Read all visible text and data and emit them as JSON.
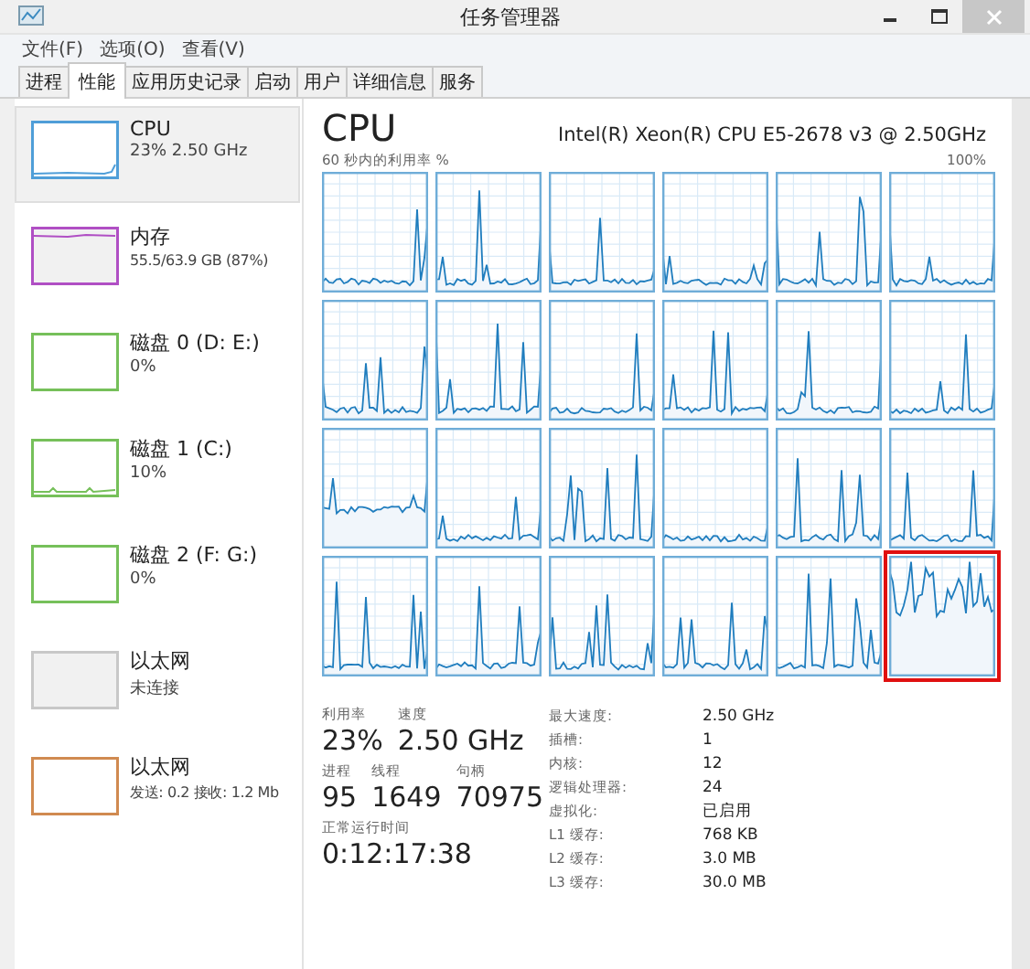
{
  "window": {
    "title": "任务管理器"
  },
  "menu": [
    "文件(F)",
    "选项(O)",
    "查看(V)"
  ],
  "tabs": [
    {
      "label": "进程",
      "selected": false
    },
    {
      "label": "性能",
      "selected": true
    },
    {
      "label": "应用历史记录",
      "selected": false
    },
    {
      "label": "启动",
      "selected": false
    },
    {
      "label": "用户",
      "selected": false
    },
    {
      "label": "详细信息",
      "selected": false
    },
    {
      "label": "服务",
      "selected": false
    }
  ],
  "sidebar": {
    "items": [
      {
        "name": "CPU",
        "detail": "23% 2.50 GHz",
        "color": "#4f9ed8",
        "selected": true
      },
      {
        "name": "内存",
        "detail": "55.5/63.9 GB (87%)",
        "color": "#b04fc4",
        "selected": false
      },
      {
        "name": "磁盘 0 (D: E:)",
        "detail": "0%",
        "color": "#76c05a",
        "selected": false
      },
      {
        "name": "磁盘 1 (C:)",
        "detail": "10%",
        "color": "#76c05a",
        "selected": false
      },
      {
        "name": "磁盘 2 (F: G:)",
        "detail": "0%",
        "color": "#76c05a",
        "selected": false
      },
      {
        "name": "以太网",
        "detail": "未连接",
        "color": "#c8c8c8",
        "selected": false
      },
      {
        "name": "以太网",
        "detail": "发送: 0.2 接收: 1.2 Mb",
        "color": "#d08a50",
        "selected": false
      }
    ]
  },
  "panel": {
    "title": "CPU",
    "processor": "Intel(R) Xeon(R) CPU E5-2678 v3 @ 2.50GHz",
    "graph_caption": "60 秒内的利用率 %",
    "graph_max": "100%",
    "core_graphs": [
      {
        "highlighted": false
      },
      {
        "highlighted": false
      },
      {
        "highlighted": false
      },
      {
        "highlighted": false
      },
      {
        "highlighted": false
      },
      {
        "highlighted": false
      },
      {
        "highlighted": false
      },
      {
        "highlighted": false
      },
      {
        "highlighted": false
      },
      {
        "highlighted": false
      },
      {
        "highlighted": false
      },
      {
        "highlighted": false
      },
      {
        "highlighted": false
      },
      {
        "highlighted": false
      },
      {
        "highlighted": false
      },
      {
        "highlighted": false
      },
      {
        "highlighted": false
      },
      {
        "highlighted": false
      },
      {
        "highlighted": false
      },
      {
        "highlighted": false
      },
      {
        "highlighted": false
      },
      {
        "highlighted": false
      },
      {
        "highlighted": false
      },
      {
        "highlighted": true
      }
    ],
    "stats": [
      [
        {
          "label": "利用率",
          "value": "23%"
        },
        {
          "label": "速度",
          "value": "2.50 GHz"
        }
      ],
      [
        {
          "label": "进程",
          "value": "95"
        },
        {
          "label": "线程",
          "value": "1649"
        },
        {
          "label": "句柄",
          "value": "70975"
        }
      ],
      [
        {
          "label": "正常运行时间",
          "value": "0:12:17:38"
        }
      ]
    ],
    "details": [
      {
        "label": "最大速度:",
        "value": "2.50 GHz"
      },
      {
        "label": "插槽:",
        "value": "1"
      },
      {
        "label": "内核:",
        "value": "12"
      },
      {
        "label": "逻辑处理器:",
        "value": "24"
      },
      {
        "label": "虚拟化:",
        "value": "已启用"
      },
      {
        "label": "L1 缓存:",
        "value": "768 KB"
      },
      {
        "label": "L2 缓存:",
        "value": "3.0 MB"
      },
      {
        "label": "L3 缓存:",
        "value": "30.0 MB"
      }
    ]
  }
}
